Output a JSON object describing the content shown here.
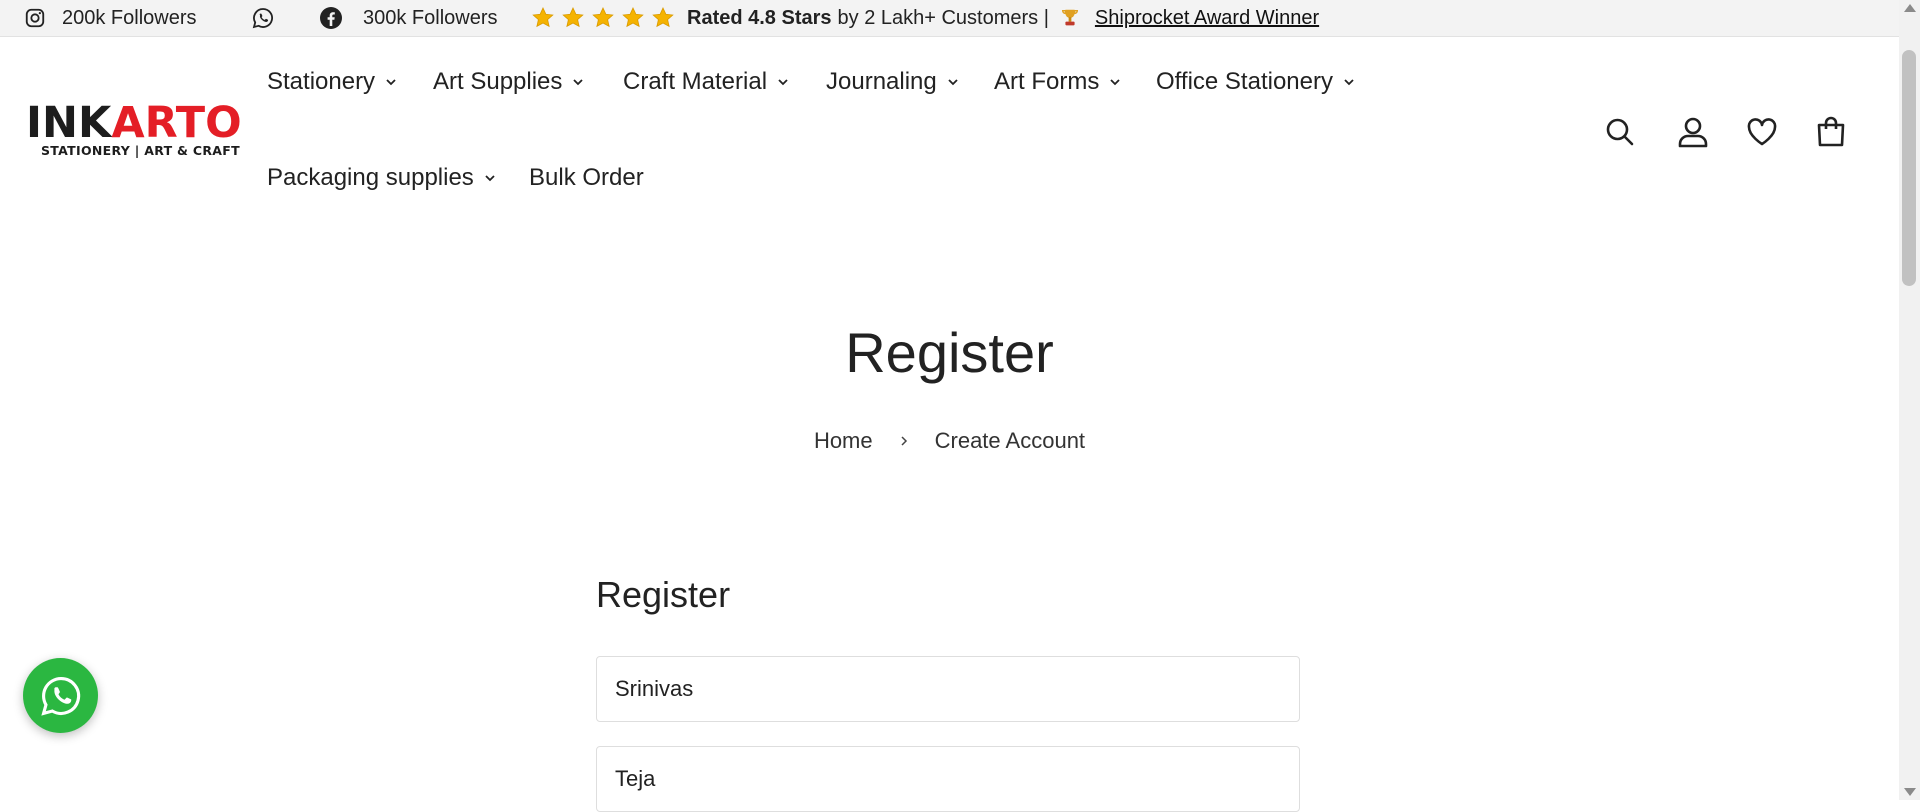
{
  "topbar": {
    "instagram_text": "200k Followers",
    "facebook_text": "300k Followers",
    "rating_bold": "Rated 4.8 Stars",
    "rating_rest": "by 2 Lakh+ Customers |",
    "award_link": "Shiprocket Award Winner",
    "star_count": 5,
    "star_color": "#f5b301"
  },
  "brand": {
    "logo_part1": "INK",
    "logo_part2": "ARTO",
    "tagline": "STATIONERY | ART & CRAFT",
    "accent": "#e41e26"
  },
  "nav": {
    "items": [
      {
        "label": "Stationery",
        "has_dropdown": true
      },
      {
        "label": "Art Supplies",
        "has_dropdown": true
      },
      {
        "label": "Craft Material",
        "has_dropdown": true
      },
      {
        "label": "Journaling",
        "has_dropdown": true
      },
      {
        "label": "Art Forms",
        "has_dropdown": true
      },
      {
        "label": "Office Stationery",
        "has_dropdown": true
      },
      {
        "label": "Packaging supplies",
        "has_dropdown": true
      },
      {
        "label": "Bulk Order",
        "has_dropdown": false
      }
    ]
  },
  "header_icons": [
    "search-icon",
    "account-icon",
    "wishlist-heart-icon",
    "cart-bag-icon"
  ],
  "page": {
    "title": "Register",
    "breadcrumb": [
      "Home",
      "Create Account"
    ]
  },
  "form": {
    "title": "Register",
    "first_name_value": "Srinivas",
    "last_name_value": "Teja"
  },
  "whatsapp": {
    "color": "#2bb741",
    "icon": "whatsapp-icon"
  }
}
